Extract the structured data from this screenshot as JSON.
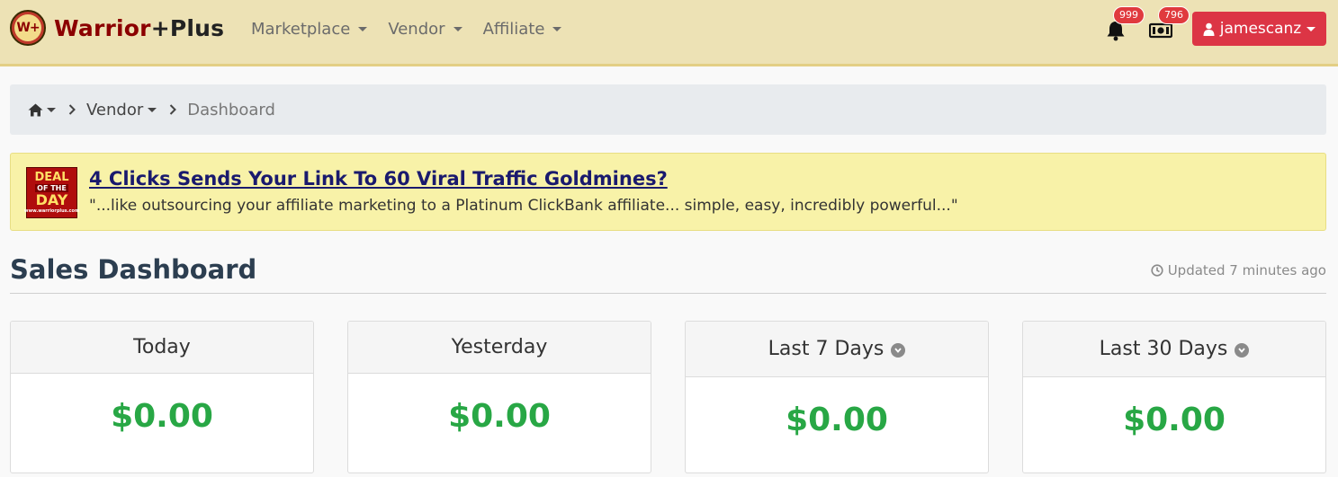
{
  "brand": {
    "logo_badge": "W+",
    "name_part1": "Warrior",
    "name_part2": "+Plus"
  },
  "nav": {
    "items": [
      {
        "label": "Marketplace"
      },
      {
        "label": "Vendor"
      },
      {
        "label": "Affiliate"
      }
    ]
  },
  "notifications": {
    "bell_count": "999",
    "money_count": "796"
  },
  "user": {
    "name": "jamescanz"
  },
  "breadcrumb": {
    "vendor": "Vendor",
    "current": "Dashboard"
  },
  "deal": {
    "logo_line1": "DEAL",
    "logo_line2": "OF THE",
    "logo_line3": "DAY",
    "logo_line4": "www.warriorplus.com",
    "title": "4 Clicks Sends Your Link To 60 Viral Traffic Goldmines?",
    "quote": "\"...like outsourcing your affiliate marketing to a Platinum ClickBank affiliate... simple, easy, incredibly powerful...\""
  },
  "dashboard": {
    "title": "Sales Dashboard",
    "updated": "Updated 7 minutes ago",
    "cards": [
      {
        "label": "Today",
        "value": "$0.00"
      },
      {
        "label": "Yesterday",
        "value": "$0.00"
      },
      {
        "label": "Last 7 Days",
        "value": "$0.00"
      },
      {
        "label": "Last 30 Days",
        "value": "$0.00"
      }
    ]
  },
  "colors": {
    "topbar": "#ede2b5",
    "user_button": "#dc3545",
    "badge": "#e03a3e",
    "money_green": "#28a745",
    "deal_bg": "#f8f2a8"
  }
}
